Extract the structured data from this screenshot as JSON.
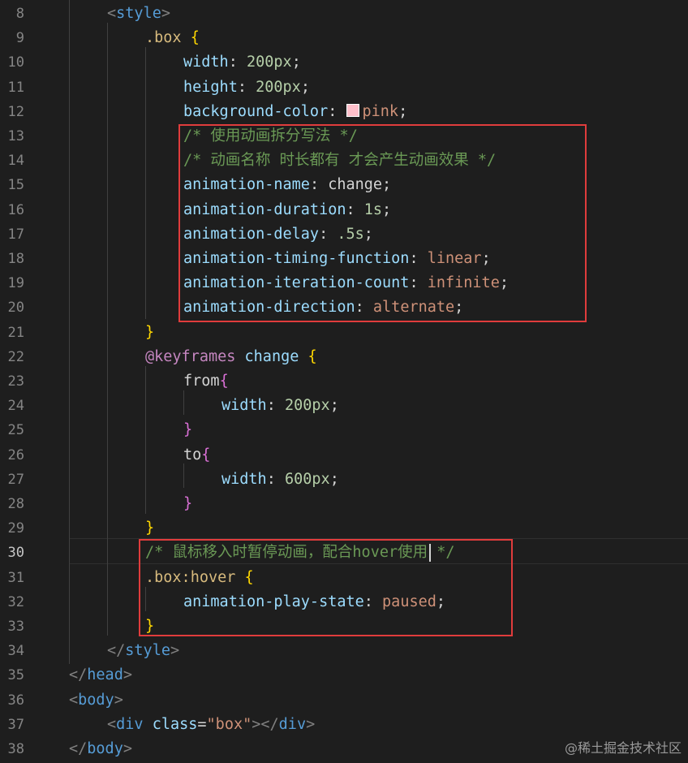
{
  "editor": {
    "lines": [
      {
        "n": "8",
        "tokens": [
          {
            "text": "<",
            "t": "punc"
          },
          {
            "text": "style",
            "t": "tag"
          },
          {
            "text": ">",
            "t": "punc"
          }
        ]
      },
      {
        "n": "9",
        "tokens": [
          {
            "text": ".box",
            "t": "sel"
          },
          {
            "text": " ",
            "t": "text"
          },
          {
            "text": "{",
            "t": "brace"
          }
        ]
      },
      {
        "n": "10",
        "tokens": [
          {
            "text": "width",
            "t": "prop"
          },
          {
            "text": ": ",
            "t": "text"
          },
          {
            "text": "200px",
            "t": "num"
          },
          {
            "text": ";",
            "t": "text"
          }
        ]
      },
      {
        "n": "11",
        "tokens": [
          {
            "text": "height",
            "t": "prop"
          },
          {
            "text": ": ",
            "t": "text"
          },
          {
            "text": "200px",
            "t": "num"
          },
          {
            "text": ";",
            "t": "text"
          }
        ]
      },
      {
        "n": "12",
        "tokens": [
          {
            "text": "background-color",
            "t": "prop"
          },
          {
            "text": ": ",
            "t": "text"
          },
          {
            "text": "",
            "t": "swatch"
          },
          {
            "text": "pink",
            "t": "val"
          },
          {
            "text": ";",
            "t": "text"
          }
        ]
      },
      {
        "n": "13",
        "tokens": [
          {
            "text": "/* 使用动画拆分写法 */",
            "t": "cmt"
          }
        ]
      },
      {
        "n": "14",
        "tokens": [
          {
            "text": "/* 动画名称 时长都有 才会产生动画效果 */",
            "t": "cmt"
          }
        ]
      },
      {
        "n": "15",
        "tokens": [
          {
            "text": "animation-name",
            "t": "prop"
          },
          {
            "text": ": ",
            "t": "text"
          },
          {
            "text": "change",
            "t": "text"
          },
          {
            "text": ";",
            "t": "text"
          }
        ]
      },
      {
        "n": "16",
        "tokens": [
          {
            "text": "animation-duration",
            "t": "prop"
          },
          {
            "text": ": ",
            "t": "text"
          },
          {
            "text": "1s",
            "t": "num"
          },
          {
            "text": ";",
            "t": "text"
          }
        ]
      },
      {
        "n": "17",
        "tokens": [
          {
            "text": "animation-delay",
            "t": "prop"
          },
          {
            "text": ": ",
            "t": "text"
          },
          {
            "text": ".5s",
            "t": "num"
          },
          {
            "text": ";",
            "t": "text"
          }
        ]
      },
      {
        "n": "18",
        "tokens": [
          {
            "text": "animation-timing-function",
            "t": "prop"
          },
          {
            "text": ": ",
            "t": "text"
          },
          {
            "text": "linear",
            "t": "val"
          },
          {
            "text": ";",
            "t": "text"
          }
        ]
      },
      {
        "n": "19",
        "tokens": [
          {
            "text": "animation-iteration-count",
            "t": "prop"
          },
          {
            "text": ": ",
            "t": "text"
          },
          {
            "text": "infinite",
            "t": "val"
          },
          {
            "text": ";",
            "t": "text"
          }
        ]
      },
      {
        "n": "20",
        "tokens": [
          {
            "text": "animation-direction",
            "t": "prop"
          },
          {
            "text": ": ",
            "t": "text"
          },
          {
            "text": "alternate",
            "t": "val"
          },
          {
            "text": ";",
            "t": "text"
          }
        ]
      },
      {
        "n": "21",
        "tokens": [
          {
            "text": "}",
            "t": "brace"
          }
        ]
      },
      {
        "n": "22",
        "tokens": [
          {
            "text": "@keyframes",
            "t": "kw"
          },
          {
            "text": " ",
            "t": "text"
          },
          {
            "text": "change",
            "t": "name"
          },
          {
            "text": " ",
            "t": "text"
          },
          {
            "text": "{",
            "t": "brace"
          }
        ]
      },
      {
        "n": "23",
        "tokens": [
          {
            "text": "from",
            "t": "text"
          },
          {
            "text": "{",
            "t": "brace2"
          }
        ]
      },
      {
        "n": "24",
        "tokens": [
          {
            "text": "width",
            "t": "prop"
          },
          {
            "text": ": ",
            "t": "text"
          },
          {
            "text": "200px",
            "t": "num"
          },
          {
            "text": ";",
            "t": "text"
          }
        ]
      },
      {
        "n": "25",
        "tokens": [
          {
            "text": "}",
            "t": "brace2"
          }
        ]
      },
      {
        "n": "26",
        "tokens": [
          {
            "text": "to",
            "t": "text"
          },
          {
            "text": "{",
            "t": "brace2"
          }
        ]
      },
      {
        "n": "27",
        "tokens": [
          {
            "text": "width",
            "t": "prop"
          },
          {
            "text": ": ",
            "t": "text"
          },
          {
            "text": "600px",
            "t": "num"
          },
          {
            "text": ";",
            "t": "text"
          }
        ]
      },
      {
        "n": "28",
        "tokens": [
          {
            "text": "}",
            "t": "brace2"
          }
        ]
      },
      {
        "n": "29",
        "tokens": [
          {
            "text": "}",
            "t": "brace"
          }
        ]
      },
      {
        "n": "30",
        "tokens": [
          {
            "text": "/* 鼠标移入时暂停动画，配合hover使用",
            "t": "cmt"
          },
          {
            "text": "",
            "t": "cursor"
          },
          {
            "text": " */",
            "t": "cmt"
          }
        ]
      },
      {
        "n": "31",
        "tokens": [
          {
            "text": ".box:hover",
            "t": "sel"
          },
          {
            "text": " ",
            "t": "text"
          },
          {
            "text": "{",
            "t": "brace"
          }
        ]
      },
      {
        "n": "32",
        "tokens": [
          {
            "text": "animation-play-state",
            "t": "prop"
          },
          {
            "text": ": ",
            "t": "text"
          },
          {
            "text": "paused",
            "t": "val"
          },
          {
            "text": ";",
            "t": "text"
          }
        ]
      },
      {
        "n": "33",
        "tokens": [
          {
            "text": "}",
            "t": "brace"
          }
        ]
      },
      {
        "n": "34",
        "tokens": [
          {
            "text": "</",
            "t": "punc"
          },
          {
            "text": "style",
            "t": "tag"
          },
          {
            "text": ">",
            "t": "punc"
          }
        ]
      },
      {
        "n": "35",
        "tokens": [
          {
            "text": "</",
            "t": "punc"
          },
          {
            "text": "head",
            "t": "tag"
          },
          {
            "text": ">",
            "t": "punc"
          }
        ]
      },
      {
        "n": "36",
        "tokens": [
          {
            "text": "<",
            "t": "punc"
          },
          {
            "text": "body",
            "t": "tag"
          },
          {
            "text": ">",
            "t": "punc"
          }
        ]
      },
      {
        "n": "37",
        "tokens": [
          {
            "text": "<",
            "t": "punc"
          },
          {
            "text": "div",
            "t": "tag"
          },
          {
            "text": " ",
            "t": "text"
          },
          {
            "text": "class",
            "t": "attr"
          },
          {
            "text": "=",
            "t": "text"
          },
          {
            "text": "\"box\"",
            "t": "str"
          },
          {
            "text": "></",
            "t": "punc"
          },
          {
            "text": "div",
            "t": "tag"
          },
          {
            "text": ">",
            "t": "punc"
          }
        ]
      },
      {
        "n": "38",
        "tokens": [
          {
            "text": "</",
            "t": "punc"
          },
          {
            "text": "body",
            "t": "tag"
          },
          {
            "text": ">",
            "t": "punc"
          }
        ]
      }
    ],
    "current_line": "30",
    "colors": {
      "background": "#1e1e1e",
      "highlight_box": "#e03c3c",
      "swatch_pink": "#ffc0cb"
    }
  },
  "watermark": "@稀土掘金技术社区"
}
